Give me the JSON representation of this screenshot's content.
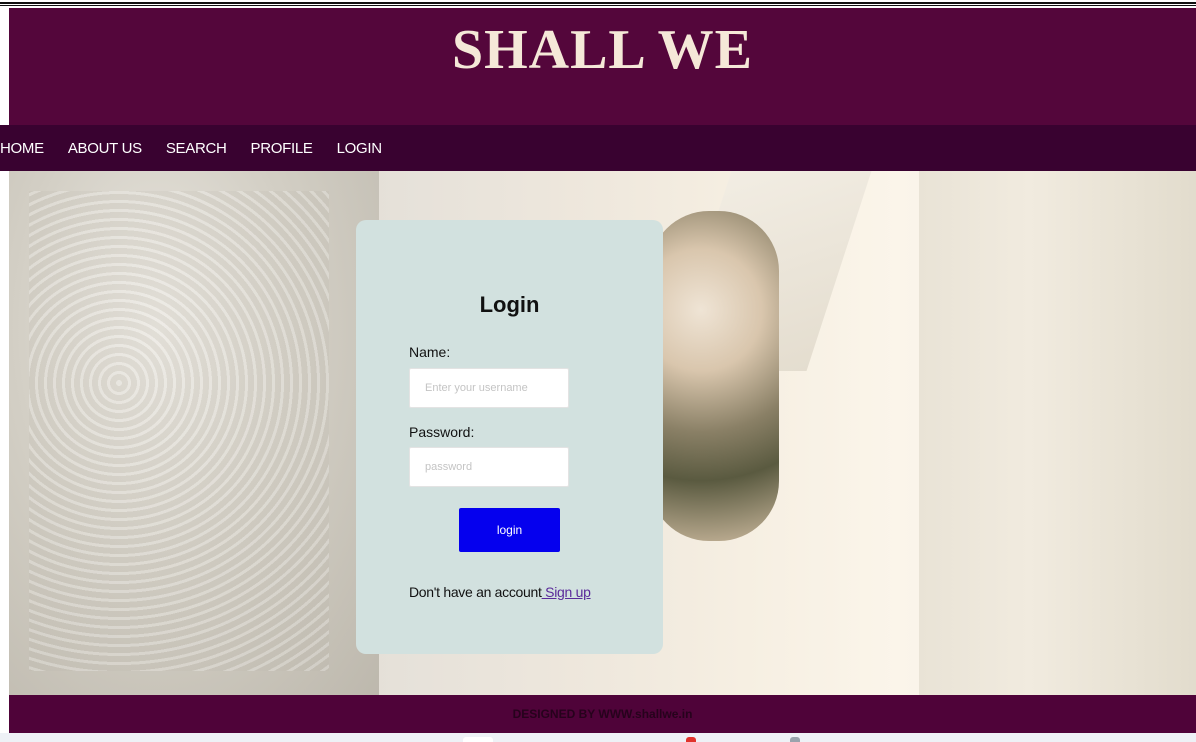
{
  "header": {
    "title": "SHALL WE"
  },
  "nav": {
    "items": [
      {
        "label": "HOME"
      },
      {
        "label": "ABOUT US"
      },
      {
        "label": "SEARCH"
      },
      {
        "label": "PROFILE"
      },
      {
        "label": "LOGIN"
      }
    ]
  },
  "login": {
    "heading": "Login",
    "name_label": "Name:",
    "name_value": "",
    "name_placeholder": "Enter your username",
    "password_label": "Password:",
    "password_value": "",
    "password_placeholder": "password",
    "button_label": "login",
    "signup_prompt": "Don't have an account",
    "signup_link": " Sign up"
  },
  "footer": {
    "text": "DESIGNED BY WWW.shallwe.in"
  },
  "colors": {
    "header_bg": "#54063b",
    "nav_bg": "#390230",
    "card_bg": "#d2e1df",
    "button_bg": "#0500ee",
    "footer_bg": "#4f0339"
  }
}
